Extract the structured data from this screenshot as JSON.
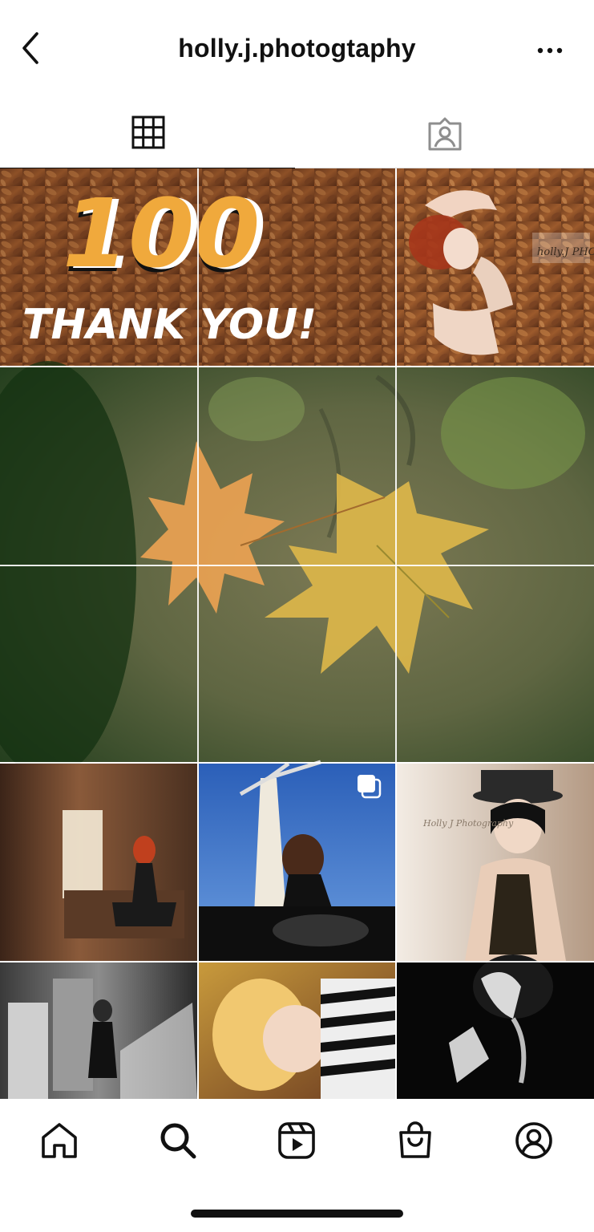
{
  "header": {
    "title": "holly.j.photogtaphy",
    "back_icon": "chevron-left-icon",
    "more_icon": "ellipsis-icon"
  },
  "tabs": [
    {
      "icon": "grid-icon",
      "active": true
    },
    {
      "icon": "tagged-person-icon",
      "active": false
    }
  ],
  "grid": {
    "banner": {
      "number_text": "100",
      "caption_text": "THANK YOU!",
      "accent_color": "#f0a93c"
    },
    "watermarks": [
      "holly.J PHOTOS",
      "Holly J Photography"
    ],
    "posts": [
      {
        "name": "post-autumn-leaves-100-left",
        "multi": false
      },
      {
        "name": "post-autumn-leaves-100-middle",
        "multi": false
      },
      {
        "name": "post-woman-in-leaves",
        "multi": false
      },
      {
        "name": "post-maple-leaf-panel",
        "multi": false
      },
      {
        "name": "post-warehouse-redhead",
        "multi": false
      },
      {
        "name": "post-windmill-motorcycle",
        "multi": true
      },
      {
        "name": "post-top-hat-portrait",
        "multi": false
      },
      {
        "name": "post-bw-staircase",
        "multi": false
      },
      {
        "name": "post-blonde-zebra",
        "multi": false
      },
      {
        "name": "post-bw-dark-portrait",
        "multi": false
      }
    ]
  },
  "bottom_nav": [
    {
      "icon": "home-icon"
    },
    {
      "icon": "search-icon"
    },
    {
      "icon": "reels-icon"
    },
    {
      "icon": "shop-bag-icon"
    },
    {
      "icon": "profile-icon"
    }
  ],
  "colors": {
    "text": "#111111",
    "divider": "#dbdbdb",
    "tab_inactive": "#8e8e8e"
  }
}
